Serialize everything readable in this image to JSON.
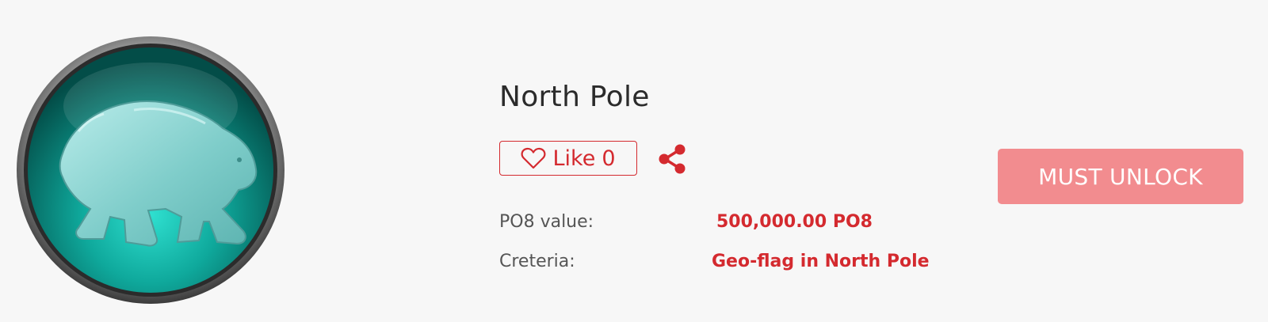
{
  "badge": {
    "icon": "polar-bear-badge-icon",
    "accent": "#0e8f86"
  },
  "item": {
    "title": "North Pole",
    "like_label": "Like",
    "like_count": "0",
    "value_label": "PO8 value:",
    "value": "500,000.00 PO8",
    "criteria_label": "Creteria:",
    "criteria": "Geo-flag in North Pole"
  },
  "actions": {
    "unlock_label": "MUST UNLOCK"
  },
  "colors": {
    "accent_red": "#d42a2f",
    "unlock_button_bg": "#f28c8f",
    "background": "#f7f7f7"
  }
}
